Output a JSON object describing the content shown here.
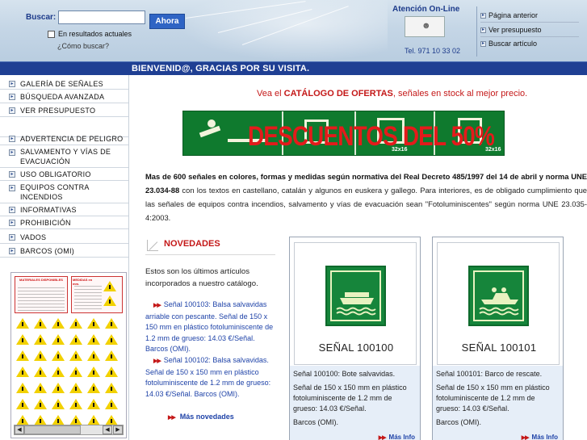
{
  "search": {
    "label": "Buscar:",
    "value": "",
    "placeholder": "",
    "button": "Ahora",
    "in_results_label": "En resultados actuales",
    "how_to_search": "¿Cómo buscar?"
  },
  "attention": {
    "title": "Atención On-Line",
    "phone": "Tel. 971 10 33 02"
  },
  "top_links": [
    "Página anterior",
    "Ver presupuesto",
    "Buscar artículo"
  ],
  "welcome": "BIENVENID@, GRACIAS POR SU VISITA.",
  "sidebar": {
    "top_items": [
      "GALERÍA DE SEÑALES",
      "BÚSQUEDA AVANZADA",
      "VER PRESUPUESTO"
    ],
    "category_items": [
      "ADVERTENCIA DE PELIGRO",
      "SALVAMENTO Y VÍAS DE EVACUACIÓN",
      "USO OBLIGATORIO",
      "EQUIPOS CONTRA INCENDIOS",
      "INFORMATIVAS",
      "PROHIBICIÓN",
      "VADOS",
      "BARCOS (OMI)"
    ]
  },
  "offer": {
    "prefix": "Vea el ",
    "link": "CATÁLOGO DE OFERTAS",
    "suffix": ", señales en stock al mejor precio."
  },
  "banner": {
    "text": "DESCUENTOS DEL 50%",
    "size_label": "32x16"
  },
  "intro": {
    "bold": "Mas de 600 señales en colores, formas y medidas según normativa del Real Decreto 485/1997 del 14 de abril y norma UNE 23.034-88",
    "rest": " con los textos en castellano, catalán y algunos en euskera y gallego. Para interiores, es de obligado cumplimiento que las señales de equipos contra incendios, salvamento y vías de evacuación sean \"Fotoluminiscentes\" según norma UNE 23.035-4:2003."
  },
  "news": {
    "title": "NOVEDADES",
    "intro": "Estos son los últimos artículos incorporados a nuestro catálogo.",
    "items": [
      "Señal 100103: Balsa salvavidas arriable con pescante. Señal de 150 x 150 mm en plástico fotoluminiscente de 1.2 mm de grueso: 14.03 €/Señal. Barcos (OMI).",
      "Señal 100102: Balsa salvavidas. Señal de 150 x 150 mm en plástico fotoluminiscente de 1.2 mm de grueso: 14.03 €/Señal. Barcos (OMI)."
    ],
    "more": "Más novedades"
  },
  "cards": [
    {
      "code": "SEÑAL 100100",
      "title": "Señal 100100: Bote salvavidas.",
      "body": "Señal de 150 x 150 mm en plástico fotoluminiscente de 1.2 mm de grueso: 14.03 €/Señal.",
      "category": "Barcos (OMI).",
      "more": "Más Info"
    },
    {
      "code": "SEÑAL 100101",
      "title": "Señal 100101: Barco de rescate.",
      "body": "Señal de 150 x 150 mm en plástico fotoluminiscente de 1.2 mm de grueso: 14.03 €/Señal.",
      "category": "Barcos (OMI).",
      "more": "Más Info"
    }
  ],
  "thumb": {
    "heading_left": "MATERIALES DISPONIBLES",
    "heading_right": "MEDIDAS en mm."
  },
  "colors": {
    "brand_blue": "#1f3f93",
    "accent_red": "#c41818",
    "sign_green": "#16853b",
    "warning_yellow": "#f2d100"
  }
}
